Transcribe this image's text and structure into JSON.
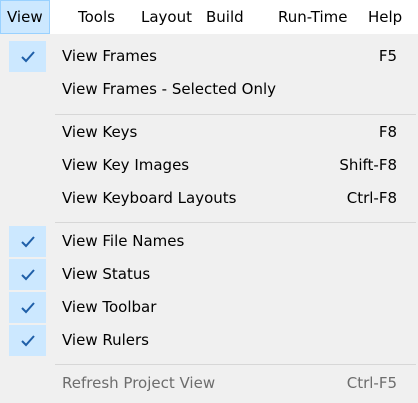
{
  "menubar": {
    "items": [
      {
        "label": "View"
      },
      {
        "label": "Tools"
      },
      {
        "label": "Layout"
      },
      {
        "label": "Build"
      },
      {
        "label": "Run-Time"
      },
      {
        "label": "Help"
      }
    ]
  },
  "menu": {
    "icon": "checkmark-icon",
    "check_color": "#1f5fa8",
    "items": [
      {
        "label": "View Frames",
        "shortcut": "F5",
        "checked": true
      },
      {
        "label": "View Frames - Selected Only",
        "shortcut": "",
        "checked": false
      },
      {
        "label": "View Keys",
        "shortcut": "F8",
        "checked": false
      },
      {
        "label": "View Key Images",
        "shortcut": "Shift-F8",
        "checked": false
      },
      {
        "label": "View Keyboard Layouts",
        "shortcut": "Ctrl-F8",
        "checked": false
      },
      {
        "label": "View File Names",
        "shortcut": "",
        "checked": true
      },
      {
        "label": "View Status",
        "shortcut": "",
        "checked": true
      },
      {
        "label": "View Toolbar",
        "shortcut": "",
        "checked": true
      },
      {
        "label": "View Rulers",
        "shortcut": "",
        "checked": true
      },
      {
        "label": "Refresh Project View",
        "shortcut": "Ctrl-F5",
        "checked": false,
        "disabled": true
      }
    ]
  }
}
